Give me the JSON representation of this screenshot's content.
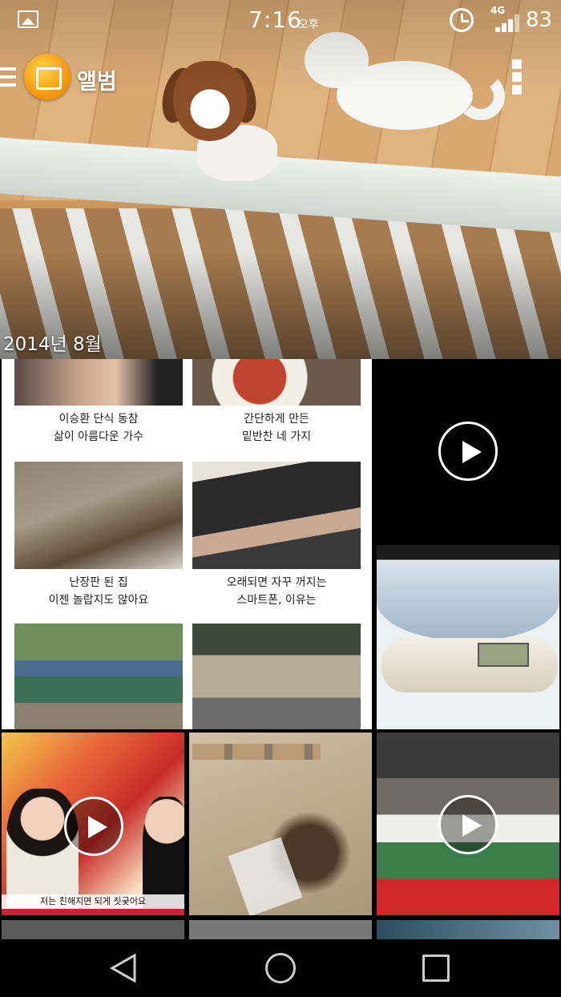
{
  "status_bar": {
    "time": "7:16",
    "ampm": "오후",
    "network": "4G",
    "battery": "83"
  },
  "app_bar": {
    "title": "앨범"
  },
  "section": {
    "date_label": "2014년 8월"
  },
  "news_items": [
    {
      "caption_line1": "이승환 단식 동참",
      "caption_line2": "삶이 아름다운 가수"
    },
    {
      "caption_line1": "간단하게 만든",
      "caption_line2": "밑반찬 네 가지"
    },
    {
      "caption_line1": "난장판 된 집",
      "caption_line2": "이젠 놀랍지도 않아요"
    },
    {
      "caption_line1": "오래되면 자꾸 꺼지는",
      "caption_line2": "스마트폰, 이유는"
    }
  ],
  "video_show": {
    "caption": "저는 친해지면 되게 짓궂어요"
  },
  "colors": {
    "accent": "#f59a0f",
    "background": "#000000"
  }
}
